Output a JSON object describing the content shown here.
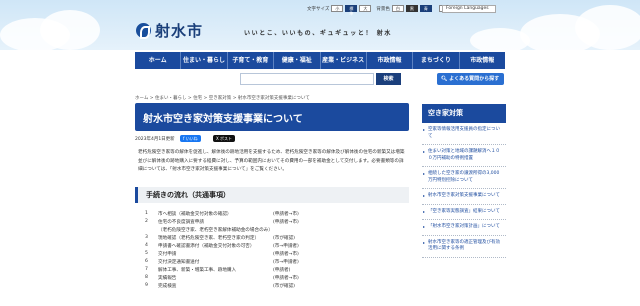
{
  "header": {
    "city_name": "射水市",
    "slogan": "いいとこ、いいもの、ギュギュッと！ 射水",
    "utility": {
      "font_size_label": "文字サイズ",
      "font_small": "小",
      "font_standard": "標準",
      "font_large": "大",
      "bg_color_label": "背景色",
      "bg_white": "白",
      "bg_black": "黒",
      "bg_blue": "青",
      "read_aloud": "読み上げ",
      "language_select": "Foreign Languages"
    }
  },
  "nav": {
    "items": [
      "ホーム",
      "住まい・暮らし",
      "子育て・教育",
      "健康・福祉",
      "産業・ビジネス",
      "市政情報",
      "まちづくり",
      "市政情報"
    ]
  },
  "search": {
    "placeholder": "",
    "button_label": "検索",
    "faq_label": "よくある質問から探す"
  },
  "breadcrumb": "ホーム > 住まい・暮らし > 住宅 > 空き家対策 > 射水市空き家対策支援事業について",
  "main": {
    "title": "射水市空き家対策支援事業について",
    "updated": "2023年4月1日更新",
    "like_label": "いいね",
    "post_label": "ポスト",
    "body": "老朽危険空き家等の解体を促進し、解体後の跡地活用を支援するため、老朽危険空き家等の解体及び解体後の住宅の新築又は増築並びに解体後の跡地購入に要する経費に対し、予算の範囲内においてその費用の一部を補助金として交付します。必要書類等の詳細については、「射水市空き家対策支援事業について」をご覧ください。",
    "section_title": "手続きの流れ（共通事項）",
    "steps": [
      {
        "num": "1",
        "label": "市へ相談（補助金交付対象の確認）",
        "who": "(申請者→市)"
      },
      {
        "num": "2",
        "label": "住宅の不良度調査申請",
        "who": "(申請者→市)"
      },
      {
        "num": "",
        "label": "（老朽危険空き家、老朽空き家解体補助金の場合のみ）",
        "who": ""
      },
      {
        "num": "3",
        "label": "現地確認（老朽危険空き家、老朽空き家の判定）",
        "who": "(市が確認)"
      },
      {
        "num": "4",
        "label": "申請書へ確認書添付（補助金交付対象の可否）",
        "who": "(市→申請者)"
      },
      {
        "num": "5",
        "label": "交付申請",
        "who": "(申請者→市)"
      },
      {
        "num": "6",
        "label": "交付決定通知書送付",
        "who": "(市→申請者)"
      },
      {
        "num": "7",
        "label": "解体工事、新築・増築工事、跡地購入",
        "who": "(申請者)"
      },
      {
        "num": "8",
        "label": "実績報告",
        "who": "(申請者→市)"
      },
      {
        "num": "9",
        "label": "完成検査",
        "who": "(市が確認)"
      }
    ]
  },
  "sidebar": {
    "title": "空き家対策",
    "items": [
      "空家等情報活用支援員の指定について",
      "住まい対策と地域の課題解消へ１００万円補助の特例措置",
      "相続した空き家の譲渡所得の3,000万円特別控除について",
      "射水市空き家対策支援事業について",
      "「空き家等実態調査」結果について",
      "「射水市空き家対策計画」について",
      "射水市空き家等の適正管理及び有効活用に関する条例"
    ]
  }
}
